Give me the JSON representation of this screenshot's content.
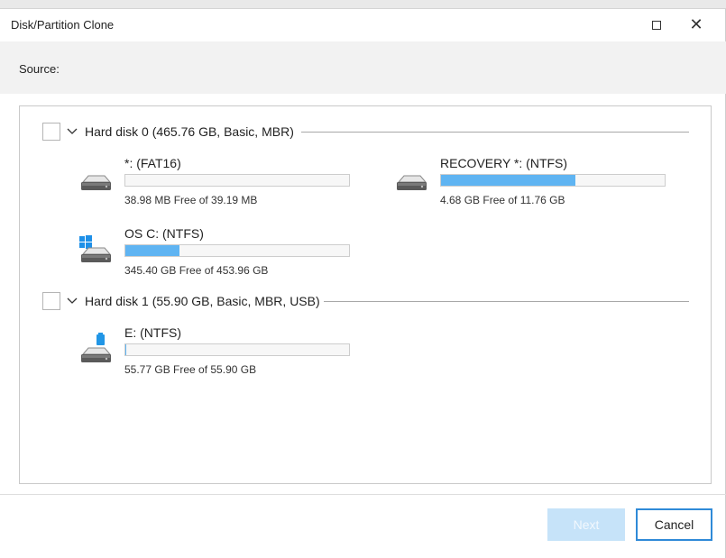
{
  "window": {
    "title": "Disk/Partition Clone",
    "controls": [
      "maximize-icon",
      "close-icon"
    ]
  },
  "source": {
    "label": "Source:"
  },
  "disks": [
    {
      "title": "Hard disk 0 (465.76 GB, Basic, MBR)",
      "checked": false,
      "expanded": true,
      "partitions": [
        {
          "name": "*: (FAT16)",
          "free_text": "38.98 MB Free of 39.19 MB",
          "used_fraction": 0.005,
          "icon": "drive-icon"
        },
        {
          "name": "RECOVERY *: (NTFS)",
          "free_text": "4.68 GB Free of 11.76 GB",
          "used_fraction": 0.602,
          "icon": "drive-icon"
        },
        {
          "name": "OS C: (NTFS)",
          "free_text": "345.40 GB Free of 453.96 GB",
          "used_fraction": 0.239,
          "icon": "windows-drive-icon"
        }
      ]
    },
    {
      "title": "Hard disk 1 (55.90 GB, Basic, MBR, USB)",
      "checked": false,
      "expanded": true,
      "partitions": [
        {
          "name": "E: (NTFS)",
          "free_text": "55.77 GB Free of 55.90 GB",
          "used_fraction": 0.002,
          "icon": "usb-drive-icon"
        }
      ]
    }
  ],
  "buttons": {
    "next": "Next",
    "cancel": "Cancel",
    "next_enabled": false
  },
  "colors": {
    "bar_fill": "#5fb4f2",
    "accent": "#2f8ad8",
    "windows_logo": "#1e90e8",
    "usb": "#2196e6"
  }
}
